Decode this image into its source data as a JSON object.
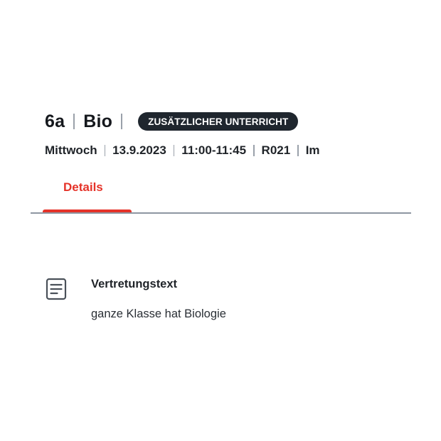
{
  "header": {
    "class_name": "6a",
    "subject": "Bio",
    "badge": "ZUSÄTZLICHER UNTERRICHT",
    "meta": {
      "weekday": "Mittwoch",
      "date": "13.9.2023",
      "time": "11:00-11:45",
      "room": "R021",
      "teacher": "Im"
    }
  },
  "tabs": [
    {
      "label": "Details",
      "active": true
    }
  ],
  "details": {
    "icon": "document-icon",
    "heading": "Vertretungstext",
    "text": "ganze Klasse hat Biologie"
  },
  "colors": {
    "accent": "#e53329",
    "badge_bg": "#1f262e",
    "divider": "#8d96a1"
  }
}
